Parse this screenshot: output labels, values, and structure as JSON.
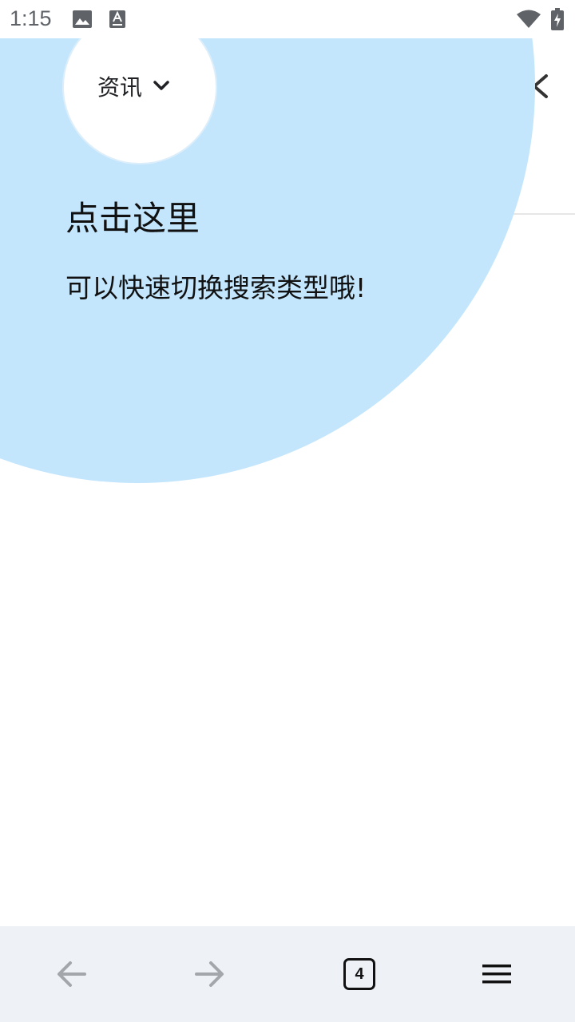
{
  "status_bar": {
    "time": "1:15",
    "icons": [
      "image-icon",
      "accessibility-font-icon",
      "wifi-icon",
      "battery-charging-icon"
    ]
  },
  "search_type": {
    "label": "资讯"
  },
  "coach_mark": {
    "title": "点击这里",
    "body": "可以快速切换搜索类型哦!"
  },
  "bottom_nav": {
    "tab_count": "4",
    "icons": [
      "back-arrow-icon",
      "forward-arrow-icon",
      "tabs-icon",
      "menu-icon"
    ]
  },
  "colors": {
    "coach_bubble": "#c3e6fd",
    "bottom_bar": "#eef2f7",
    "status_text": "#5f6368"
  }
}
